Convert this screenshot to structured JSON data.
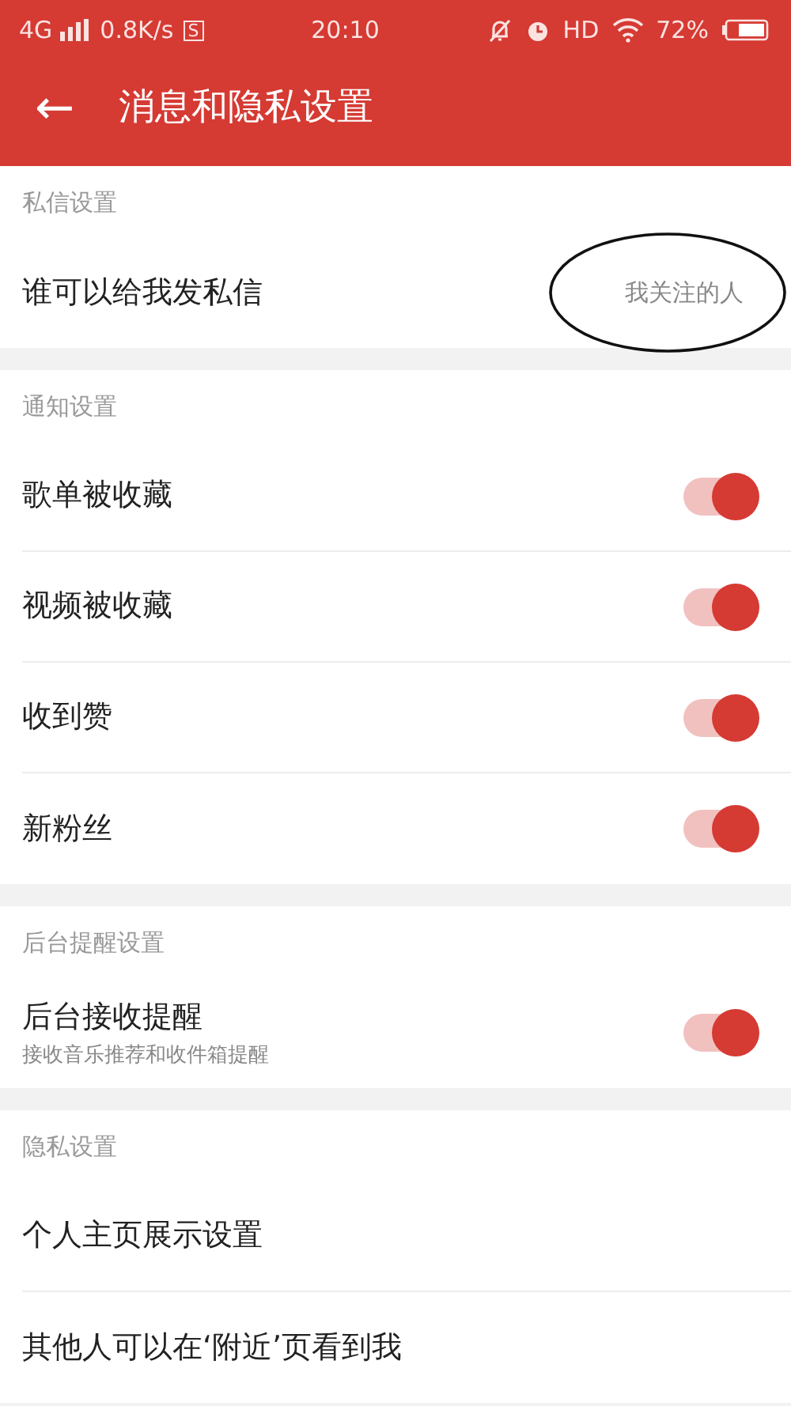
{
  "status_bar": {
    "network": "4G",
    "speed": "0.8K/s",
    "badge": "S",
    "time": "20:10",
    "hd": "HD",
    "battery": "72%"
  },
  "header": {
    "back": "←",
    "title": "消息和隐私设置"
  },
  "sections": [
    {
      "title": "私信设置",
      "items": [
        {
          "kind": "value",
          "label": "谁可以给我发私信",
          "value": "我关注的人",
          "circled": true
        }
      ]
    },
    {
      "title": "通知设置",
      "items": [
        {
          "kind": "toggle",
          "label": "歌单被收藏",
          "on": true
        },
        {
          "kind": "toggle",
          "label": "视频被收藏",
          "on": true
        },
        {
          "kind": "toggle",
          "label": "收到赞",
          "on": true
        },
        {
          "kind": "toggle",
          "label": "新粉丝",
          "on": true
        }
      ]
    },
    {
      "title": "后台提醒设置",
      "items": [
        {
          "kind": "toggle",
          "label": "后台接收提醒",
          "sub": "接收音乐推荐和收件箱提醒",
          "on": true
        }
      ]
    },
    {
      "title": "隐私设置",
      "items": [
        {
          "kind": "link",
          "label": "个人主页展示设置"
        },
        {
          "kind": "link",
          "label": "其他人可以在‘附近’页看到我"
        }
      ]
    }
  ]
}
